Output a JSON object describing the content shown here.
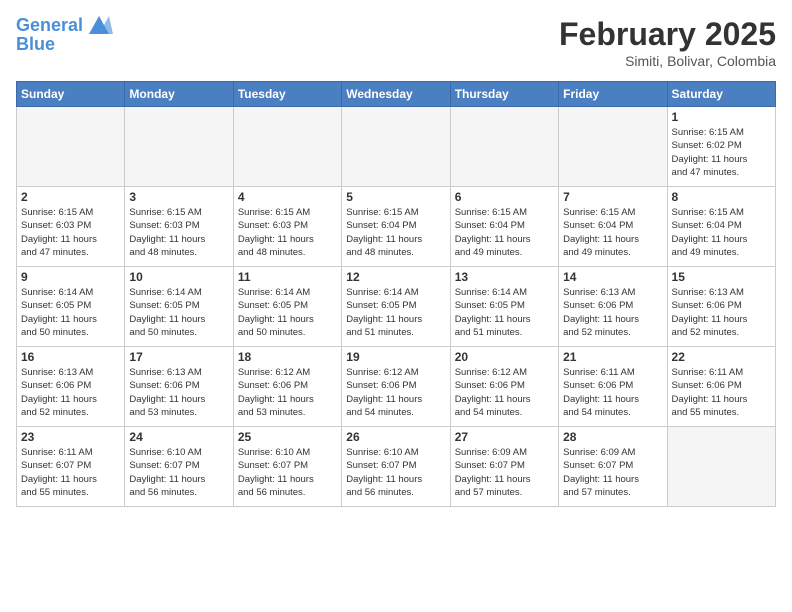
{
  "header": {
    "logo_line1": "General",
    "logo_line2": "Blue",
    "month": "February 2025",
    "location": "Simiti, Bolivar, Colombia"
  },
  "days_of_week": [
    "Sunday",
    "Monday",
    "Tuesday",
    "Wednesday",
    "Thursday",
    "Friday",
    "Saturday"
  ],
  "weeks": [
    [
      {
        "day": "",
        "info": ""
      },
      {
        "day": "",
        "info": ""
      },
      {
        "day": "",
        "info": ""
      },
      {
        "day": "",
        "info": ""
      },
      {
        "day": "",
        "info": ""
      },
      {
        "day": "",
        "info": ""
      },
      {
        "day": "1",
        "info": "Sunrise: 6:15 AM\nSunset: 6:02 PM\nDaylight: 11 hours\nand 47 minutes."
      }
    ],
    [
      {
        "day": "2",
        "info": "Sunrise: 6:15 AM\nSunset: 6:03 PM\nDaylight: 11 hours\nand 47 minutes."
      },
      {
        "day": "3",
        "info": "Sunrise: 6:15 AM\nSunset: 6:03 PM\nDaylight: 11 hours\nand 48 minutes."
      },
      {
        "day": "4",
        "info": "Sunrise: 6:15 AM\nSunset: 6:03 PM\nDaylight: 11 hours\nand 48 minutes."
      },
      {
        "day": "5",
        "info": "Sunrise: 6:15 AM\nSunset: 6:04 PM\nDaylight: 11 hours\nand 48 minutes."
      },
      {
        "day": "6",
        "info": "Sunrise: 6:15 AM\nSunset: 6:04 PM\nDaylight: 11 hours\nand 49 minutes."
      },
      {
        "day": "7",
        "info": "Sunrise: 6:15 AM\nSunset: 6:04 PM\nDaylight: 11 hours\nand 49 minutes."
      },
      {
        "day": "8",
        "info": "Sunrise: 6:15 AM\nSunset: 6:04 PM\nDaylight: 11 hours\nand 49 minutes."
      }
    ],
    [
      {
        "day": "9",
        "info": "Sunrise: 6:14 AM\nSunset: 6:05 PM\nDaylight: 11 hours\nand 50 minutes."
      },
      {
        "day": "10",
        "info": "Sunrise: 6:14 AM\nSunset: 6:05 PM\nDaylight: 11 hours\nand 50 minutes."
      },
      {
        "day": "11",
        "info": "Sunrise: 6:14 AM\nSunset: 6:05 PM\nDaylight: 11 hours\nand 50 minutes."
      },
      {
        "day": "12",
        "info": "Sunrise: 6:14 AM\nSunset: 6:05 PM\nDaylight: 11 hours\nand 51 minutes."
      },
      {
        "day": "13",
        "info": "Sunrise: 6:14 AM\nSunset: 6:05 PM\nDaylight: 11 hours\nand 51 minutes."
      },
      {
        "day": "14",
        "info": "Sunrise: 6:13 AM\nSunset: 6:06 PM\nDaylight: 11 hours\nand 52 minutes."
      },
      {
        "day": "15",
        "info": "Sunrise: 6:13 AM\nSunset: 6:06 PM\nDaylight: 11 hours\nand 52 minutes."
      }
    ],
    [
      {
        "day": "16",
        "info": "Sunrise: 6:13 AM\nSunset: 6:06 PM\nDaylight: 11 hours\nand 52 minutes."
      },
      {
        "day": "17",
        "info": "Sunrise: 6:13 AM\nSunset: 6:06 PM\nDaylight: 11 hours\nand 53 minutes."
      },
      {
        "day": "18",
        "info": "Sunrise: 6:12 AM\nSunset: 6:06 PM\nDaylight: 11 hours\nand 53 minutes."
      },
      {
        "day": "19",
        "info": "Sunrise: 6:12 AM\nSunset: 6:06 PM\nDaylight: 11 hours\nand 54 minutes."
      },
      {
        "day": "20",
        "info": "Sunrise: 6:12 AM\nSunset: 6:06 PM\nDaylight: 11 hours\nand 54 minutes."
      },
      {
        "day": "21",
        "info": "Sunrise: 6:11 AM\nSunset: 6:06 PM\nDaylight: 11 hours\nand 54 minutes."
      },
      {
        "day": "22",
        "info": "Sunrise: 6:11 AM\nSunset: 6:06 PM\nDaylight: 11 hours\nand 55 minutes."
      }
    ],
    [
      {
        "day": "23",
        "info": "Sunrise: 6:11 AM\nSunset: 6:07 PM\nDaylight: 11 hours\nand 55 minutes."
      },
      {
        "day": "24",
        "info": "Sunrise: 6:10 AM\nSunset: 6:07 PM\nDaylight: 11 hours\nand 56 minutes."
      },
      {
        "day": "25",
        "info": "Sunrise: 6:10 AM\nSunset: 6:07 PM\nDaylight: 11 hours\nand 56 minutes."
      },
      {
        "day": "26",
        "info": "Sunrise: 6:10 AM\nSunset: 6:07 PM\nDaylight: 11 hours\nand 56 minutes."
      },
      {
        "day": "27",
        "info": "Sunrise: 6:09 AM\nSunset: 6:07 PM\nDaylight: 11 hours\nand 57 minutes."
      },
      {
        "day": "28",
        "info": "Sunrise: 6:09 AM\nSunset: 6:07 PM\nDaylight: 11 hours\nand 57 minutes."
      },
      {
        "day": "",
        "info": ""
      }
    ]
  ]
}
